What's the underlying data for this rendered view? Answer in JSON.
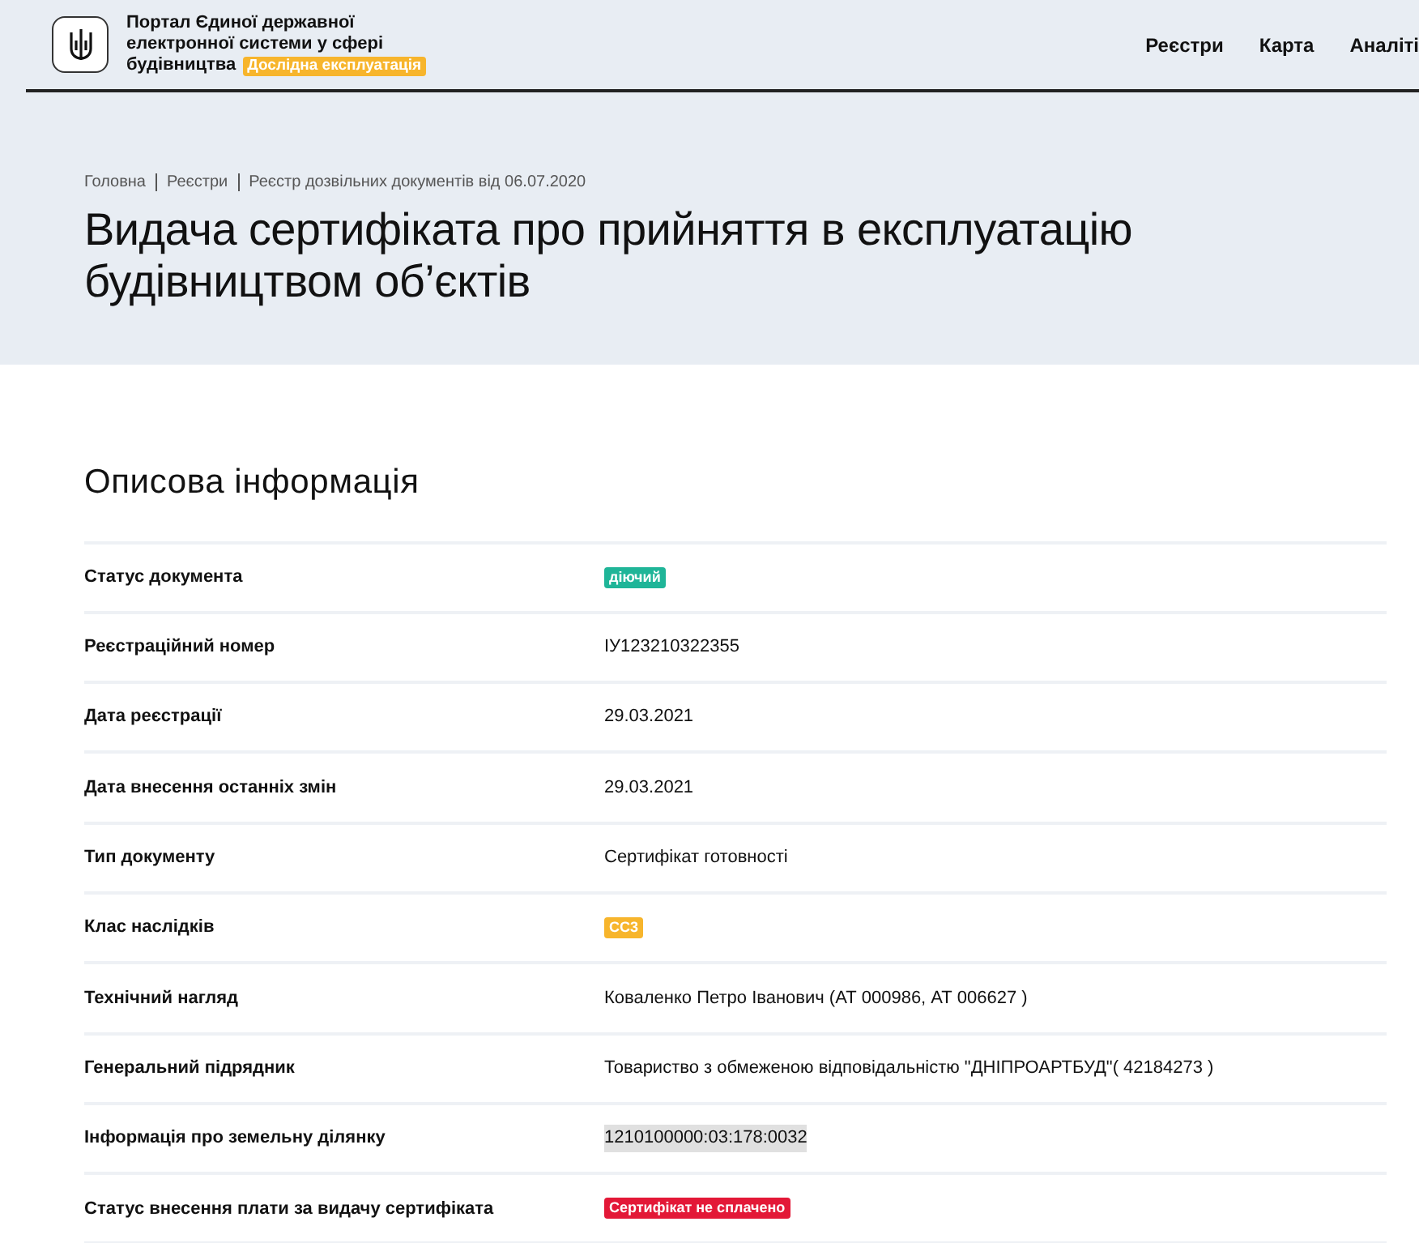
{
  "header": {
    "title_lines": [
      "Портал Єдиної державної",
      "електронної системи у сфері",
      "будівництва"
    ],
    "badge": "Дослідна експлуатація",
    "nav": [
      "Реєстри",
      "Карта",
      "Аналіті"
    ]
  },
  "breadcrumbs": [
    "Головна",
    "Реєстри",
    "Реєстр дозвільних документів від 06.07.2020"
  ],
  "page_title": "Видача сертифіката про прийняття в експлуатацію будівництвом об’єктів",
  "section_title": "Описова інформація",
  "rows": [
    {
      "label": "Статус документа",
      "kind": "badge",
      "value": "діючий",
      "color": "#1fb598"
    },
    {
      "label": "Реєстраційний номер",
      "kind": "text",
      "value": "ІУ123210322355"
    },
    {
      "label": "Дата реєстрації",
      "kind": "text",
      "value": "29.03.2021"
    },
    {
      "label": "Дата внесення останніх змін",
      "kind": "text",
      "value": "29.03.2021"
    },
    {
      "label": "Тип документу",
      "kind": "text",
      "value": "Сертифікат готовності"
    },
    {
      "label": "Клас наслідків",
      "kind": "badge",
      "value": "СС3",
      "color": "#f7b52c"
    },
    {
      "label": "Технічний нагляд",
      "kind": "text",
      "value": "Коваленко Петро Іванович (АТ 000986, АТ 006627 )"
    },
    {
      "label": "Генеральний підрядник",
      "kind": "text",
      "value": "Товариство з обмеженою відповідальністю \"ДНІПРОАРТБУД\"( 42184273 )"
    },
    {
      "label": "Інформація про земельну ділянку",
      "kind": "highlight",
      "value": "1210100000:03:178:0032"
    },
    {
      "label": "Статус внесення плати за видачу сертифіката",
      "kind": "badge",
      "value": "Сертифікат не сплачено",
      "color": "#e31837"
    }
  ]
}
